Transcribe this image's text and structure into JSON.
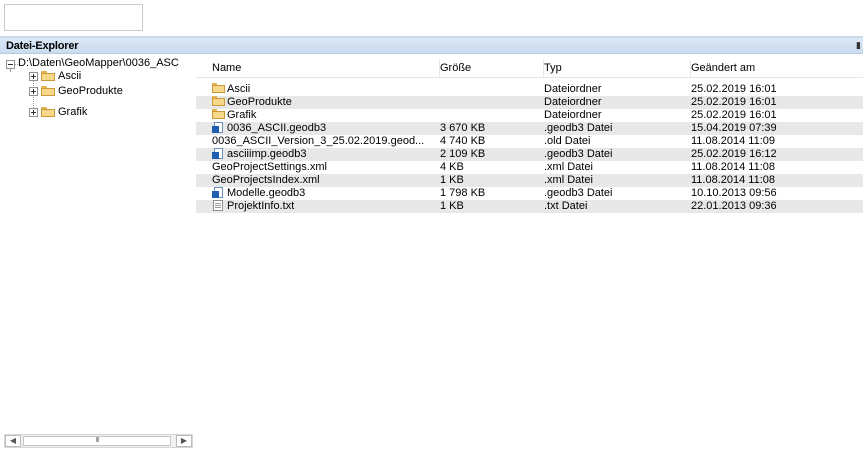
{
  "panel": {
    "title": "Datei-Explorer",
    "pin_icon": "pin-icon"
  },
  "tree": {
    "root": "D:\\Daten\\GeoMapper\\0036_ASC",
    "children": [
      {
        "label": "Ascii",
        "icon": "folder-icon"
      },
      {
        "label": "GeoProdukte",
        "icon": "folder-icon"
      },
      {
        "label": "Grafik",
        "icon": "folder-icon"
      }
    ]
  },
  "list": {
    "columns": [
      "Name",
      "Größe",
      "Typ",
      "Geändert am"
    ],
    "rows": [
      {
        "name": "Ascii",
        "size": "",
        "type": "Dateiordner",
        "modified": "25.02.2019 16:01",
        "icon": "folder"
      },
      {
        "name": "GeoProdukte",
        "size": "",
        "type": "Dateiordner",
        "modified": "25.02.2019 16:01",
        "icon": "folder"
      },
      {
        "name": "Grafik",
        "size": "",
        "type": "Dateiordner",
        "modified": "25.02.2019 16:01",
        "icon": "folder"
      },
      {
        "name": "0036_ASCII.geodb3",
        "size": "3 670 KB",
        "type": ".geodb3 Datei",
        "modified": "15.04.2019 07:39",
        "icon": "db"
      },
      {
        "name": "0036_ASCII_Version_3_25.02.2019.geod...",
        "size": "4 740 KB",
        "type": ".old Datei",
        "modified": "11.08.2014 11:09",
        "icon": "none"
      },
      {
        "name": "asciiimp.geodb3",
        "size": "2 109 KB",
        "type": ".geodb3 Datei",
        "modified": "25.02.2019 16:12",
        "icon": "db"
      },
      {
        "name": "GeoProjectSettings.xml",
        "size": "4 KB",
        "type": ".xml Datei",
        "modified": "11.08.2014 11:08",
        "icon": "none"
      },
      {
        "name": "GeoProjectsIndex.xml",
        "size": "1 KB",
        "type": ".xml Datei",
        "modified": "11.08.2014 11:08",
        "icon": "none"
      },
      {
        "name": "Modelle.geodb3",
        "size": "1 798 KB",
        "type": ".geodb3 Datei",
        "modified": "10.10.2013 09:56",
        "icon": "db"
      },
      {
        "name": "ProjektInfo.txt",
        "size": "1 KB",
        "type": ".txt Datei",
        "modified": "22.01.2013 09:36",
        "icon": "txt"
      }
    ]
  },
  "scrollbar": {
    "thumb_grip": "III"
  }
}
